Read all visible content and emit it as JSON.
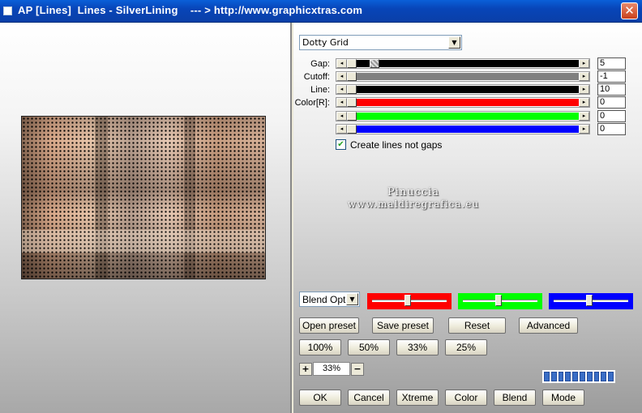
{
  "window": {
    "title": "AP [Lines]  Lines - SilverLining    --- > http://www.graphicxtras.com",
    "close_glyph": "✕"
  },
  "effect": {
    "selected": "Dotty Grid"
  },
  "params": [
    {
      "label": "Gap:",
      "value": "5",
      "color": "#000000",
      "thumb_fraction": 0.0,
      "secondary_fraction": 0.05
    },
    {
      "label": "Cutoff:",
      "value": "-1",
      "color": "#808080",
      "thumb_fraction": 0.0
    },
    {
      "label": "Line:",
      "value": "10",
      "color": "#000000",
      "thumb_fraction": 0.0
    },
    {
      "label": "Color[R]:",
      "value": "0",
      "color": "#ff0000",
      "thumb_fraction": 0.0
    },
    {
      "label": "",
      "value": "0",
      "color": "#00ff00",
      "thumb_fraction": 0.0
    },
    {
      "label": "",
      "value": "0",
      "color": "#0000ff",
      "thumb_fraction": 0.0
    }
  ],
  "options": {
    "create_lines_not_gaps_label": "Create lines not gaps",
    "create_lines_not_gaps_checked": true,
    "check_glyph": "✔"
  },
  "watermark": {
    "line1": "Pinuccia",
    "line2": "www.maldiregrafica.eu"
  },
  "blend": {
    "selected": "Blend Options",
    "channels": [
      {
        "color": "#ff0000",
        "level": 0.5
      },
      {
        "color": "#00ff00",
        "level": 0.5
      },
      {
        "color": "#0000ff",
        "level": 0.5
      }
    ]
  },
  "buttons": {
    "open_preset": "Open preset",
    "save_preset": "Save preset",
    "reset": "Reset",
    "advanced": "Advanced",
    "zoom100": "100%",
    "zoom50": "50%",
    "zoom33": "33%",
    "zoom25": "25%",
    "ok": "OK",
    "cancel": "Cancel",
    "xtreme": "Xtreme",
    "color": "Color",
    "blend": "Blend",
    "mode": "Mode"
  },
  "zoom": {
    "plus": "+",
    "value": "33%",
    "minus": "−"
  },
  "progress": {
    "segments": 10,
    "filled_fraction": 1.0
  },
  "glyphs": {
    "dropdown": "▼",
    "arrow_left": "◂",
    "arrow_right": "▸"
  }
}
